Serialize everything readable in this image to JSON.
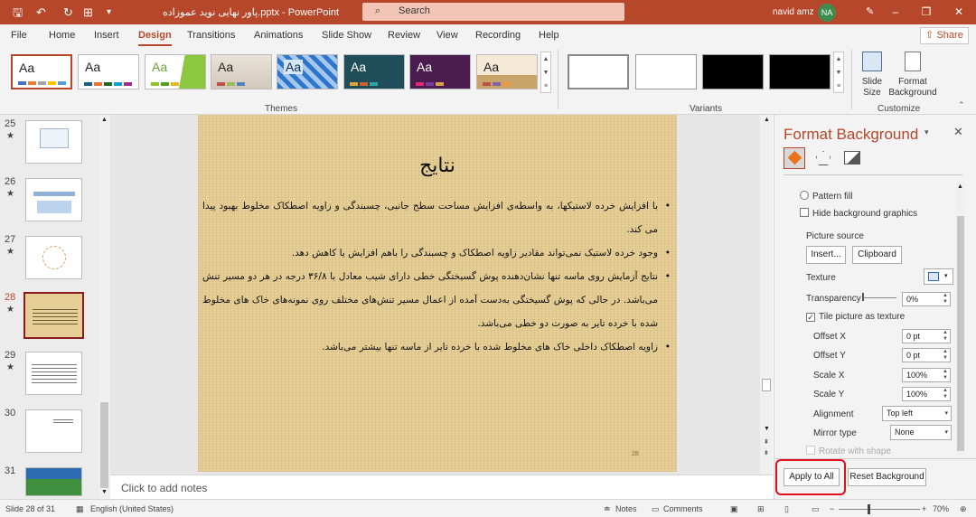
{
  "titlebar": {
    "doc_title": "پاور نهایی نوید عموزاده.pptx  -  PowerPoint",
    "search_placeholder": "Search",
    "user_name": "navid amz",
    "user_initials": "NA"
  },
  "tabs": [
    "File",
    "Home",
    "Insert",
    "Design",
    "Transitions",
    "Animations",
    "Slide Show",
    "Review",
    "View",
    "Recording",
    "Help"
  ],
  "active_tab": "Design",
  "share_label": "Share",
  "ribbon": {
    "themes_label": "Themes",
    "variants_label": "Variants",
    "customize_label": "Customize",
    "theme_sample": "Aa",
    "slide_size_label": "Slide Size",
    "format_background_label": "Format Background"
  },
  "thumbnails": [
    {
      "num": "25",
      "star": "★"
    },
    {
      "num": "26",
      "star": "★"
    },
    {
      "num": "27",
      "star": "★"
    },
    {
      "num": "28",
      "star": "★"
    },
    {
      "num": "29",
      "star": "★"
    },
    {
      "num": "30",
      "star": ""
    },
    {
      "num": "31",
      "star": ""
    }
  ],
  "slide": {
    "title": "نتایج",
    "bullets": [
      "با افزایش خرده لاستیکها، به واسطه‌ی افزایش مساحت سطح جانبی، چسبندگی و زاویه اصطکاک مخلوط بهبود پیدا می کند.",
      "وجود خرده لاستیک نمی‌تواند مقادیر زاویه اصطکاک و چسبندگی را باهم افزایش یا کاهش دهد.",
      "نتایج آزمایش روی ماسه تنها نشان‌دهنده پوش گسیختگی خطی دارای شیب معادل با ۳۶/۸ درجه در هر دو مسیر تنش می‌باشد. در حالی که پوش گسیختگی به‌دست آمده از اعمال مسیر تنش‌های مختلف روی نمونه‌های خاک های مخلوط شده با خرده تایر به صورت دو خطی می‌باشد.",
      "زاویه اصطکاک داخلی خاک های مخلوط شده با خرده تایر از ماسه تنها بیشتر می‌باشد."
    ],
    "slide_number": "28"
  },
  "notes_placeholder": "Click to add notes",
  "pane": {
    "title": "Format Background",
    "pattern_fill": "Pattern fill",
    "hide_bg_graphics": "Hide background graphics",
    "picture_source": "Picture source",
    "insert_btn": "Insert...",
    "clipboard_btn": "Clipboard",
    "texture_label": "Texture",
    "transparency_label": "Transparency",
    "transparency_value": "0%",
    "tile_label": "Tile picture as texture",
    "offset_x_label": "Offset X",
    "offset_x_value": "0 pt",
    "offset_y_label": "Offset Y",
    "offset_y_value": "0 pt",
    "scale_x_label": "Scale X",
    "scale_x_value": "100%",
    "scale_y_label": "Scale Y",
    "scale_y_value": "100%",
    "alignment_label": "Alignment",
    "alignment_value": "Top left",
    "mirror_label": "Mirror type",
    "mirror_value": "None",
    "rotate_label": "Rotate with shape",
    "apply_all_btn": "Apply to All",
    "reset_btn": "Reset Background"
  },
  "status": {
    "slide_info": "Slide 28 of 31",
    "language": "English (United States)",
    "notes_btn": "Notes",
    "comments_btn": "Comments",
    "zoom": "70%"
  },
  "colors": {
    "accent": "#b7472a",
    "highlight": "#e0101e",
    "texture": "#e6cf96"
  }
}
